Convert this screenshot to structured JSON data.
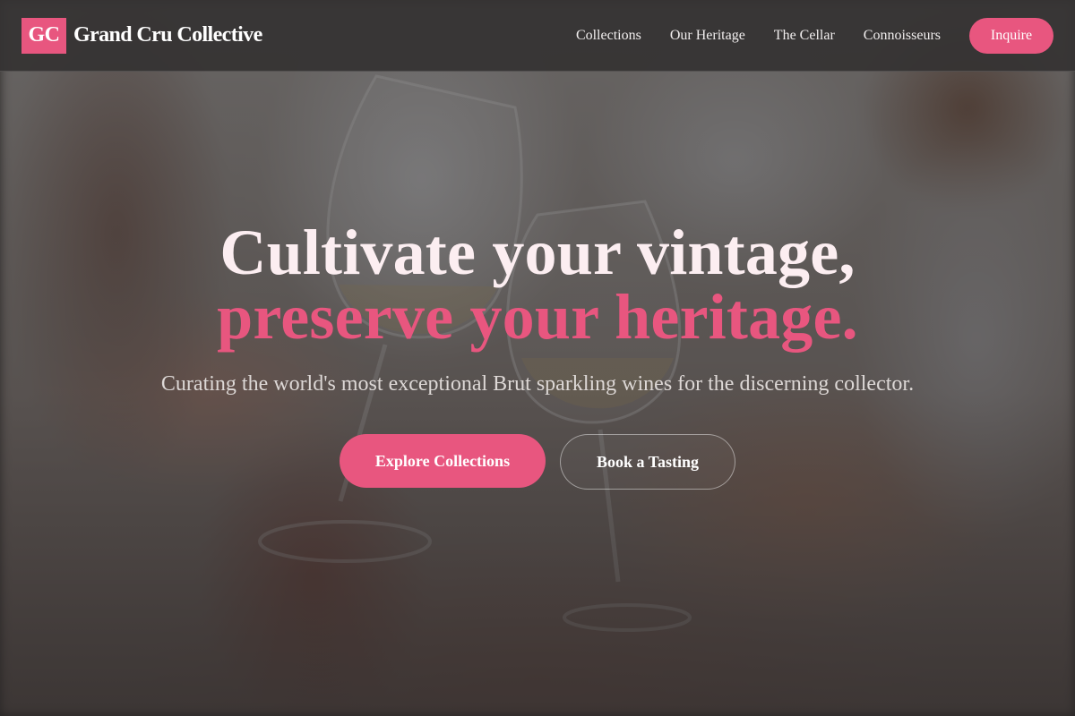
{
  "brand": {
    "logo_text": "GC",
    "name": "Grand Cru Collective"
  },
  "nav": {
    "items": [
      {
        "label": "Collections"
      },
      {
        "label": "Our Heritage"
      },
      {
        "label": "The Cellar"
      },
      {
        "label": "Connoisseurs"
      }
    ],
    "cta_label": "Inquire"
  },
  "hero": {
    "headline_line1": "Cultivate your vintage,",
    "headline_line2": "preserve your heritage.",
    "subheadline": "Curating the world's most exceptional Brut sparkling wines for the discerning collector.",
    "primary_cta": "Explore Collections",
    "secondary_cta": "Book a Tasting"
  },
  "colors": {
    "accent": "#e8567f",
    "header_bg": "#343232",
    "headline_light": "#fceef1"
  }
}
